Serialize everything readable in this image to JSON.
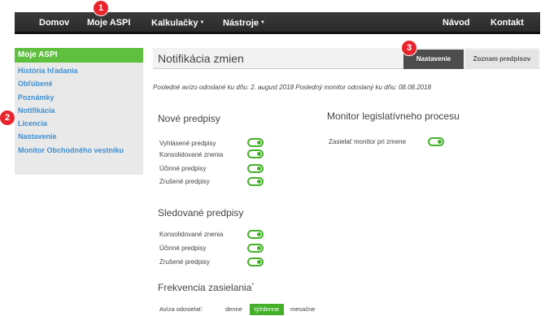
{
  "topnav": {
    "items": [
      "Domov",
      "Moje ASPI",
      "Kalkulačky",
      "Nástroje",
      "Návod",
      "Kontakt"
    ]
  },
  "callouts": [
    "1",
    "2",
    "3"
  ],
  "sidebar": {
    "header": "Moje ASPI",
    "items": [
      {
        "label": "História hľadania"
      },
      {
        "label": "Obľúbené"
      },
      {
        "label": "Poznámky"
      },
      {
        "label": "Notifikácia"
      },
      {
        "label": "Licencia"
      },
      {
        "label": "Nastavenie"
      },
      {
        "label": "Monitor Obchodného vestníku"
      }
    ]
  },
  "main": {
    "title": "Notifikácia zmien",
    "tabs": {
      "active": "Nastavenie",
      "inactive": "Zoznam predpisov"
    },
    "last_info": "Posledné avízo odoslané ku dňu: 2. august 2018  Posledný monitor odoslaný ku dňu: 08.08.2018",
    "new_regs": {
      "title": "Nové predpisy",
      "items": [
        "Vyhlásené predpisy",
        "Konsolidované znenia",
        "Účinné predpisy",
        "Zrušené predpisy"
      ]
    },
    "monitor": {
      "title": "Monitor legislatívneho procesu",
      "item": "Zasielať monitor pri zmene"
    },
    "followed": {
      "title": "Sledované predpisy",
      "items": [
        "Konsolidované znenia",
        "Účinné predpisy",
        "Zrušené predpisy"
      ]
    },
    "frequency": {
      "title": "Frekvencia zasielania",
      "asterisk": "*",
      "label": "Avíza odosielať:",
      "options": [
        "denne",
        "týždenne",
        "mesačne"
      ]
    }
  },
  "colors": {
    "accent_green": "#44b02a",
    "sidebar_header": "#5fbf3e",
    "link_blue": "#3f8fd0",
    "callout_red": "#e8242c",
    "nav_dark": "#2a2a2a"
  }
}
